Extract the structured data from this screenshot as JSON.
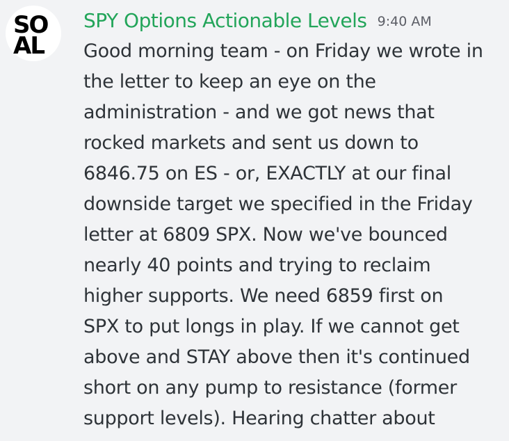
{
  "message": {
    "avatar": {
      "line1": "SO",
      "line2": "AL"
    },
    "author": "SPY Options Actionable Levels",
    "timestamp": "9:40 AM",
    "lines": [
      "Good morning team - on Friday we wrote in",
      "the letter to keep an eye on the",
      "administration - and we got news that",
      "rocked markets and sent us down to",
      "6846.75 on ES - or, EXACTLY at our final",
      "downside target we specified in the Friday",
      "letter at 6809 SPX.  Now we've bounced",
      "nearly 40 points and trying to reclaim",
      "higher supports.  We need 6859 first on",
      "SPX to put longs in play.  If we cannot get",
      "above and STAY above then it's continued",
      "short on any pump to resistance (former",
      "support levels). Hearing chatter about"
    ]
  },
  "colors": {
    "background": "#f2f3f5",
    "author": "#23a55a",
    "text": "#2e3338",
    "timestamp": "#5c5e66"
  }
}
